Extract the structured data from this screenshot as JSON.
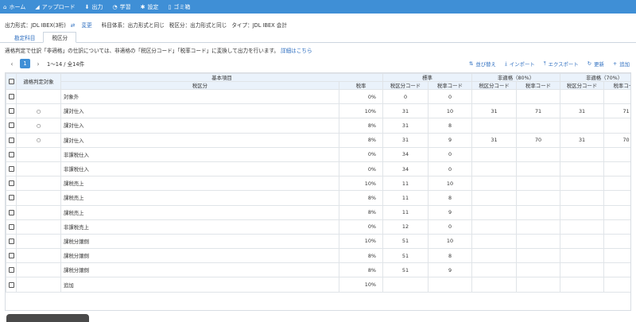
{
  "nav": [
    {
      "icon": "home-icon",
      "glyph": "⌂",
      "label": "ホーム"
    },
    {
      "icon": "upload-icon",
      "glyph": "◢",
      "label": "アップロード"
    },
    {
      "icon": "download-icon",
      "glyph": "⬇",
      "label": "出力"
    },
    {
      "icon": "learn-icon",
      "glyph": "◔",
      "label": "学習"
    },
    {
      "icon": "gear-icon",
      "glyph": "✱",
      "label": "設定"
    },
    {
      "icon": "trash-icon",
      "glyph": "▯",
      "label": "ゴミ箱"
    }
  ],
  "info": {
    "output_format": "出力形式：JDL IBEX(3桁)",
    "change_link": "変更",
    "account_system": "科目体系：出力形式と同じ",
    "tax_category": "税区分：出力形式と同じ",
    "type": "タイプ：JDL IBEX 会計"
  },
  "tabs": [
    {
      "label": "勘定科目",
      "active": false
    },
    {
      "label": "税区分",
      "active": true
    }
  ],
  "notice": {
    "text": "適格判定で仕訳「非適格」の仕訳については、非適格の「税区分コード」「税率コード」に変換して出力を行います。",
    "link": "詳細はこちら"
  },
  "pagination": {
    "prev": "‹",
    "current": "1",
    "next": "›",
    "info": "1〜14 / 全14件"
  },
  "actions": [
    {
      "icon": "sort-icon",
      "glyph": "⇅",
      "label": "並び替え"
    },
    {
      "icon": "import-icon",
      "glyph": "⤓",
      "label": "インポート"
    },
    {
      "icon": "export-icon",
      "glyph": "⤒",
      "label": "エクスポート"
    },
    {
      "icon": "refresh-icon",
      "glyph": "↻",
      "label": "更新"
    },
    {
      "icon": "add-icon",
      "glyph": "+",
      "label": "追加"
    }
  ],
  "table": {
    "headers": {
      "qual": "適格判定対象",
      "basic": "基本項目",
      "standard": "標準",
      "nq80": "非適格（80%）",
      "nq70": "非適格（70%）",
      "tax_class": "税区分",
      "rate": "税率",
      "std_code": "税区分コード",
      "std_rate": "税率コード",
      "nq80_code": "税区分コード",
      "nq80_rate": "税率コード",
      "nq70_code": "税区分コード",
      "nq70_rate": "税率コード"
    },
    "rows": [
      {
        "qual": "",
        "name": "対象外",
        "rate": "0%",
        "sc": "0",
        "sr": "0",
        "a": "",
        "b": "",
        "c": "",
        "d": ""
      },
      {
        "qual": "○",
        "name": "課対仕入",
        "rate": "10%",
        "sc": "31",
        "sr": "10",
        "a": "31",
        "b": "71",
        "c": "31",
        "d": "71"
      },
      {
        "qual": "○",
        "name": "課対仕入",
        "rate": "8%",
        "sc": "31",
        "sr": "8",
        "a": "",
        "b": "",
        "c": "",
        "d": ""
      },
      {
        "qual": "○",
        "name": "課対仕入",
        "rate": "8%",
        "sc": "31",
        "sr": "9",
        "a": "31",
        "b": "70",
        "c": "31",
        "d": "70"
      },
      {
        "qual": "",
        "name": "非課税仕入",
        "rate": "0%",
        "sc": "34",
        "sr": "0",
        "a": "",
        "b": "",
        "c": "",
        "d": ""
      },
      {
        "qual": "",
        "name": "非課税仕入",
        "rate": "0%",
        "sc": "34",
        "sr": "0",
        "a": "",
        "b": "",
        "c": "",
        "d": ""
      },
      {
        "qual": "",
        "name": "課税売上",
        "rate": "10%",
        "sc": "11",
        "sr": "10",
        "a": "",
        "b": "",
        "c": "",
        "d": ""
      },
      {
        "qual": "",
        "name": "課税売上",
        "rate": "8%",
        "sc": "11",
        "sr": "8",
        "a": "",
        "b": "",
        "c": "",
        "d": ""
      },
      {
        "qual": "",
        "name": "課税売上",
        "rate": "8%",
        "sc": "11",
        "sr": "9",
        "a": "",
        "b": "",
        "c": "",
        "d": ""
      },
      {
        "qual": "",
        "name": "非課税売上",
        "rate": "0%",
        "sc": "12",
        "sr": "0",
        "a": "",
        "b": "",
        "c": "",
        "d": ""
      },
      {
        "qual": "",
        "name": "課税分譲側",
        "rate": "10%",
        "sc": "51",
        "sr": "10",
        "a": "",
        "b": "",
        "c": "",
        "d": ""
      },
      {
        "qual": "",
        "name": "課税分譲側",
        "rate": "8%",
        "sc": "51",
        "sr": "8",
        "a": "",
        "b": "",
        "c": "",
        "d": ""
      },
      {
        "qual": "",
        "name": "課税分譲側",
        "rate": "8%",
        "sc": "51",
        "sr": "9",
        "a": "",
        "b": "",
        "c": "",
        "d": ""
      },
      {
        "qual": "",
        "name": "追加",
        "rate": "10%",
        "sc": "",
        "sr": "",
        "a": "",
        "b": "",
        "c": "",
        "d": ""
      }
    ]
  }
}
